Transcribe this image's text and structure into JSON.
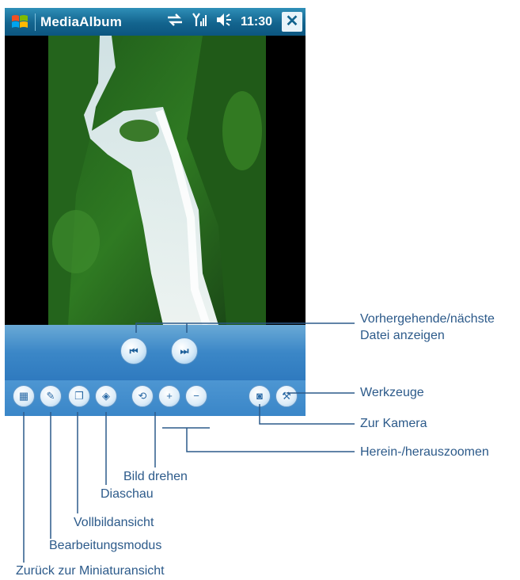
{
  "window": {
    "title": "MediaAlbum",
    "clock": "11:30",
    "close_label": "✕"
  },
  "icons": {
    "start": "windows-start-icon",
    "sync": "sync-arrows-icon",
    "signal": "signal-icon",
    "volume": "volume-icon"
  },
  "viewer": {
    "image_description": "waterfall-photo"
  },
  "nav": {
    "prev_label": "⏮",
    "next_label": "⏭"
  },
  "toolbar": {
    "thumbnail": "▦",
    "edit": "✎",
    "fullscreen": "❐",
    "slideshow": "◈",
    "rotate": "⟲",
    "zoom_in": "+",
    "zoom_out": "−",
    "camera": "◙",
    "tools": "⚒"
  },
  "annotations": {
    "prev_next_line1": "Vorhergehende/nächste",
    "prev_next_line2": "Datei anzeigen",
    "tools": "Werkzeuge",
    "camera": "Zur Kamera",
    "zoom": "Herein-/herauszoomen",
    "rotate": "Bild drehen",
    "slideshow": "Diaschau",
    "fullscreen": "Vollbildansicht",
    "edit_mode": "Bearbeitungsmodus",
    "thumbnail": "Zurück zur Miniaturansicht"
  },
  "colors": {
    "titlebar": "#13648e",
    "toolbar": "#3a86c8",
    "annotation_text": "#2c5a8a",
    "annotation_line": "#2c5a8a"
  }
}
